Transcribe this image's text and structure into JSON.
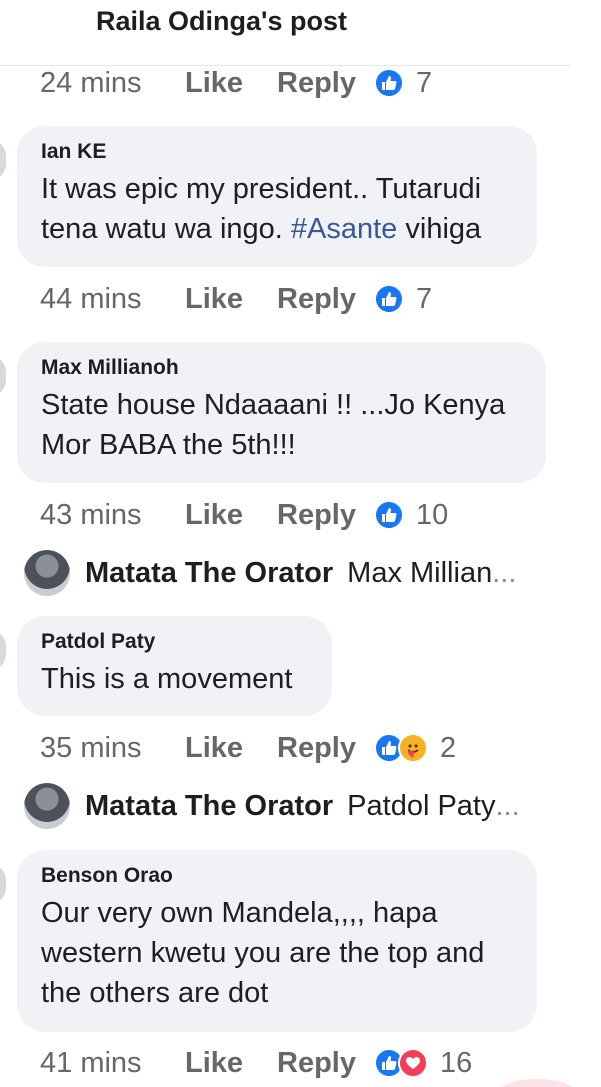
{
  "header": {
    "title": "Raila Odinga's post"
  },
  "labels": {
    "like": "Like",
    "reply": "Reply"
  },
  "colors": {
    "accent": "#1877f2",
    "love": "#f33e58",
    "care": "#f7b125",
    "bubble": "#f0f2f5"
  },
  "top_actions": {
    "time": "24 mins",
    "reaction_count": "7",
    "reactions": [
      "like-icon"
    ]
  },
  "comments": [
    {
      "name": "Ian KE",
      "lines": [
        "It was epic my president.. Tutarudi"
      ],
      "line2_pre": "tena watu wa ingo. ",
      "line2_hashtag": "#Asante",
      "line2_post": " vihiga",
      "time": "44 mins",
      "reaction_count": "7",
      "reactions": [
        "like-icon"
      ]
    },
    {
      "name": "Max Millianoh",
      "lines": [
        "State house Ndaaaani !! ...Jo Kenya",
        "Mor BABA the 5th!!!"
      ],
      "time": "43 mins",
      "reaction_count": "10",
      "reactions": [
        "like-icon"
      ]
    },
    {
      "name": "Patdol Paty",
      "lines": [
        "This is a movement"
      ],
      "time": "35 mins",
      "reaction_count": "2",
      "reactions": [
        "like-icon",
        "care-icon"
      ]
    },
    {
      "name": "Benson Orao",
      "lines": [
        "Our very own Mandela,,,, hapa",
        "western kwetu you are the top and",
        "the others are dot"
      ],
      "time": "41 mins",
      "reaction_count": "16",
      "reactions": [
        "like-icon",
        "love-icon"
      ]
    }
  ],
  "replies": [
    {
      "name": "Matata The Orator",
      "preview": "Max Millian",
      "ellipsis": "..."
    },
    {
      "name": "Matata The Orator",
      "preview": "Patdol Paty",
      "ellipsis": "..."
    }
  ]
}
